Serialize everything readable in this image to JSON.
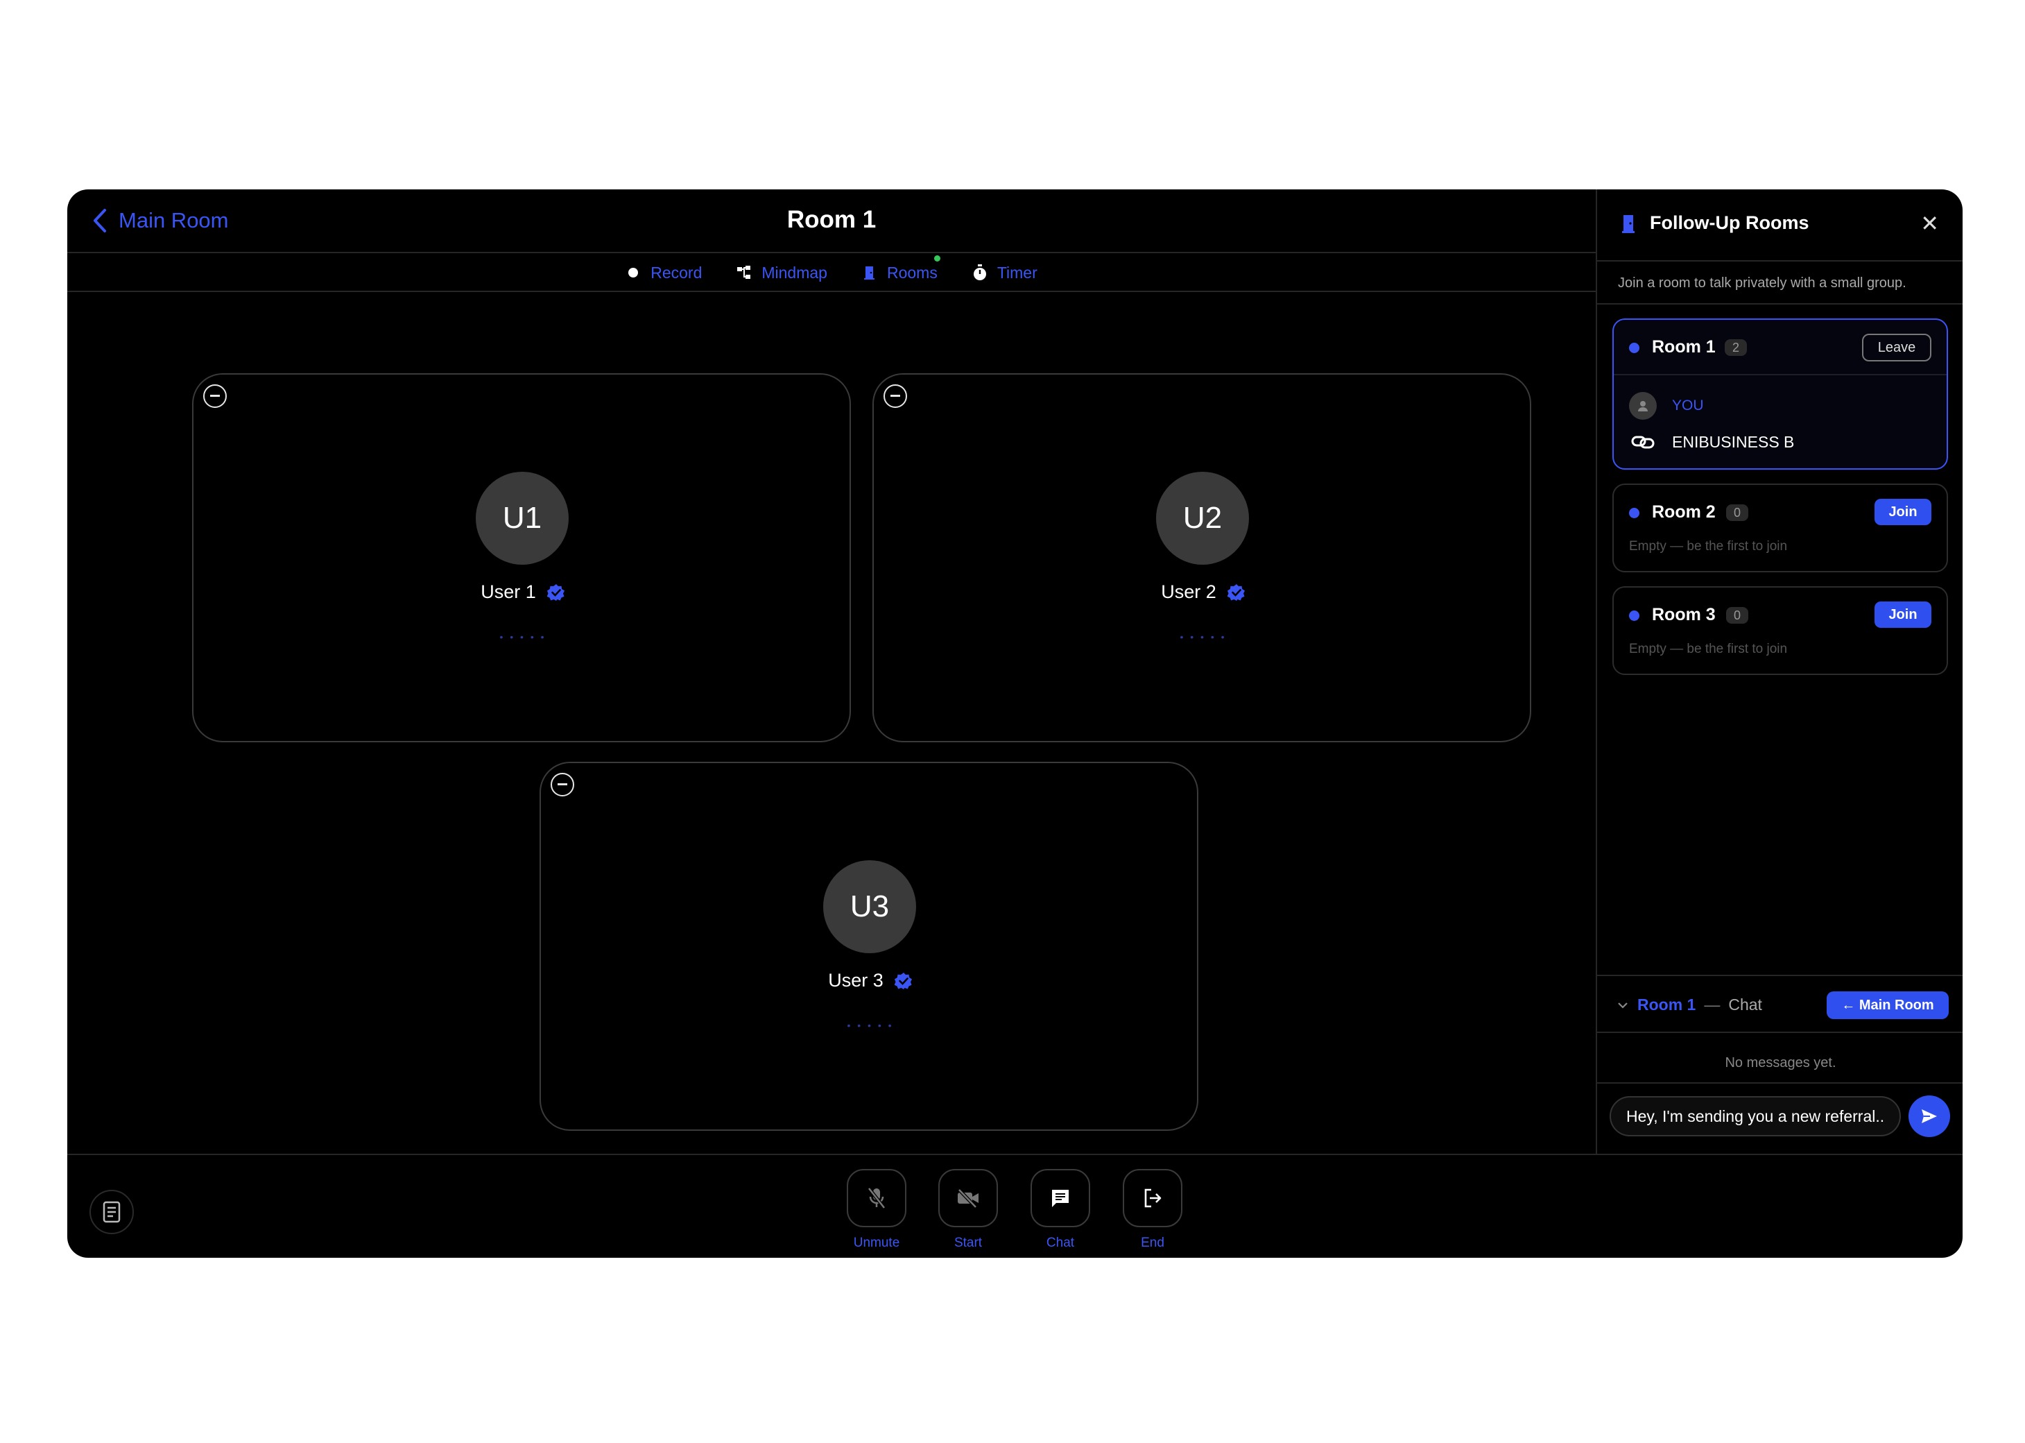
{
  "header": {
    "back_label": "Main Room",
    "title": "Room 1"
  },
  "toolbar": {
    "items": [
      {
        "label": "Record",
        "icon": "record-dot-icon"
      },
      {
        "label": "Mindmap",
        "icon": "mindmap-icon"
      },
      {
        "label": "Rooms",
        "icon": "door-icon",
        "indicator_color": "#35c759"
      },
      {
        "label": "Timer",
        "icon": "stopwatch-icon"
      }
    ]
  },
  "participants": [
    {
      "initials": "U1",
      "name": "User 1",
      "verified": true
    },
    {
      "initials": "U2",
      "name": "User 2",
      "verified": true
    },
    {
      "initials": "U3",
      "name": "User 3",
      "verified": true
    }
  ],
  "controls": {
    "unmute": "Unmute",
    "start": "Start",
    "chat": "Chat",
    "end": "End"
  },
  "panel": {
    "title": "Follow-Up Rooms",
    "subtitle": "Join a room to talk privately with a small group.",
    "rooms": [
      {
        "name": "Room 1",
        "count": "2",
        "action": "Leave",
        "members": [
          {
            "name": "YOU"
          },
          {
            "name": "ENIBUSINESS B"
          }
        ]
      },
      {
        "name": "Room 2",
        "count": "0",
        "action": "Join",
        "empty_text": "Empty — be the first to join"
      },
      {
        "name": "Room 3",
        "count": "0",
        "action": "Join",
        "empty_text": "Empty — be the first to join"
      }
    ],
    "chat": {
      "room": "Room 1",
      "separator": "—",
      "label": "Chat",
      "main_room_button": "← Main Room",
      "empty": "No messages yet.",
      "input_value": "Hey, I'm sending you a new referral.."
    }
  },
  "colors": {
    "accent": "#2f50ef",
    "link": "#3b55f5",
    "background": "#000000",
    "indicator": "#35c759"
  }
}
